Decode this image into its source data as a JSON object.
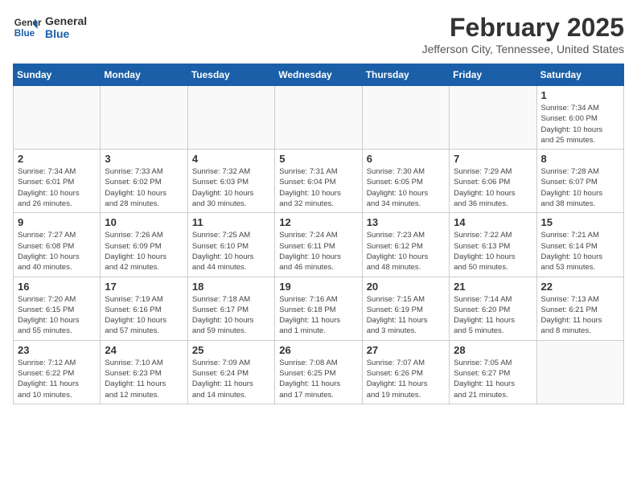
{
  "header": {
    "logo_general": "General",
    "logo_blue": "Blue",
    "month": "February 2025",
    "location": "Jefferson City, Tennessee, United States"
  },
  "days_of_week": [
    "Sunday",
    "Monday",
    "Tuesday",
    "Wednesday",
    "Thursday",
    "Friday",
    "Saturday"
  ],
  "weeks": [
    [
      {
        "day": "",
        "info": ""
      },
      {
        "day": "",
        "info": ""
      },
      {
        "day": "",
        "info": ""
      },
      {
        "day": "",
        "info": ""
      },
      {
        "day": "",
        "info": ""
      },
      {
        "day": "",
        "info": ""
      },
      {
        "day": "1",
        "info": "Sunrise: 7:34 AM\nSunset: 6:00 PM\nDaylight: 10 hours\nand 25 minutes."
      }
    ],
    [
      {
        "day": "2",
        "info": "Sunrise: 7:34 AM\nSunset: 6:01 PM\nDaylight: 10 hours\nand 26 minutes."
      },
      {
        "day": "3",
        "info": "Sunrise: 7:33 AM\nSunset: 6:02 PM\nDaylight: 10 hours\nand 28 minutes."
      },
      {
        "day": "4",
        "info": "Sunrise: 7:32 AM\nSunset: 6:03 PM\nDaylight: 10 hours\nand 30 minutes."
      },
      {
        "day": "5",
        "info": "Sunrise: 7:31 AM\nSunset: 6:04 PM\nDaylight: 10 hours\nand 32 minutes."
      },
      {
        "day": "6",
        "info": "Sunrise: 7:30 AM\nSunset: 6:05 PM\nDaylight: 10 hours\nand 34 minutes."
      },
      {
        "day": "7",
        "info": "Sunrise: 7:29 AM\nSunset: 6:06 PM\nDaylight: 10 hours\nand 36 minutes."
      },
      {
        "day": "8",
        "info": "Sunrise: 7:28 AM\nSunset: 6:07 PM\nDaylight: 10 hours\nand 38 minutes."
      }
    ],
    [
      {
        "day": "9",
        "info": "Sunrise: 7:27 AM\nSunset: 6:08 PM\nDaylight: 10 hours\nand 40 minutes."
      },
      {
        "day": "10",
        "info": "Sunrise: 7:26 AM\nSunset: 6:09 PM\nDaylight: 10 hours\nand 42 minutes."
      },
      {
        "day": "11",
        "info": "Sunrise: 7:25 AM\nSunset: 6:10 PM\nDaylight: 10 hours\nand 44 minutes."
      },
      {
        "day": "12",
        "info": "Sunrise: 7:24 AM\nSunset: 6:11 PM\nDaylight: 10 hours\nand 46 minutes."
      },
      {
        "day": "13",
        "info": "Sunrise: 7:23 AM\nSunset: 6:12 PM\nDaylight: 10 hours\nand 48 minutes."
      },
      {
        "day": "14",
        "info": "Sunrise: 7:22 AM\nSunset: 6:13 PM\nDaylight: 10 hours\nand 50 minutes."
      },
      {
        "day": "15",
        "info": "Sunrise: 7:21 AM\nSunset: 6:14 PM\nDaylight: 10 hours\nand 53 minutes."
      }
    ],
    [
      {
        "day": "16",
        "info": "Sunrise: 7:20 AM\nSunset: 6:15 PM\nDaylight: 10 hours\nand 55 minutes."
      },
      {
        "day": "17",
        "info": "Sunrise: 7:19 AM\nSunset: 6:16 PM\nDaylight: 10 hours\nand 57 minutes."
      },
      {
        "day": "18",
        "info": "Sunrise: 7:18 AM\nSunset: 6:17 PM\nDaylight: 10 hours\nand 59 minutes."
      },
      {
        "day": "19",
        "info": "Sunrise: 7:16 AM\nSunset: 6:18 PM\nDaylight: 11 hours\nand 1 minute."
      },
      {
        "day": "20",
        "info": "Sunrise: 7:15 AM\nSunset: 6:19 PM\nDaylight: 11 hours\nand 3 minutes."
      },
      {
        "day": "21",
        "info": "Sunrise: 7:14 AM\nSunset: 6:20 PM\nDaylight: 11 hours\nand 5 minutes."
      },
      {
        "day": "22",
        "info": "Sunrise: 7:13 AM\nSunset: 6:21 PM\nDaylight: 11 hours\nand 8 minutes."
      }
    ],
    [
      {
        "day": "23",
        "info": "Sunrise: 7:12 AM\nSunset: 6:22 PM\nDaylight: 11 hours\nand 10 minutes."
      },
      {
        "day": "24",
        "info": "Sunrise: 7:10 AM\nSunset: 6:23 PM\nDaylight: 11 hours\nand 12 minutes."
      },
      {
        "day": "25",
        "info": "Sunrise: 7:09 AM\nSunset: 6:24 PM\nDaylight: 11 hours\nand 14 minutes."
      },
      {
        "day": "26",
        "info": "Sunrise: 7:08 AM\nSunset: 6:25 PM\nDaylight: 11 hours\nand 17 minutes."
      },
      {
        "day": "27",
        "info": "Sunrise: 7:07 AM\nSunset: 6:26 PM\nDaylight: 11 hours\nand 19 minutes."
      },
      {
        "day": "28",
        "info": "Sunrise: 7:05 AM\nSunset: 6:27 PM\nDaylight: 11 hours\nand 21 minutes."
      },
      {
        "day": "",
        "info": ""
      }
    ]
  ]
}
